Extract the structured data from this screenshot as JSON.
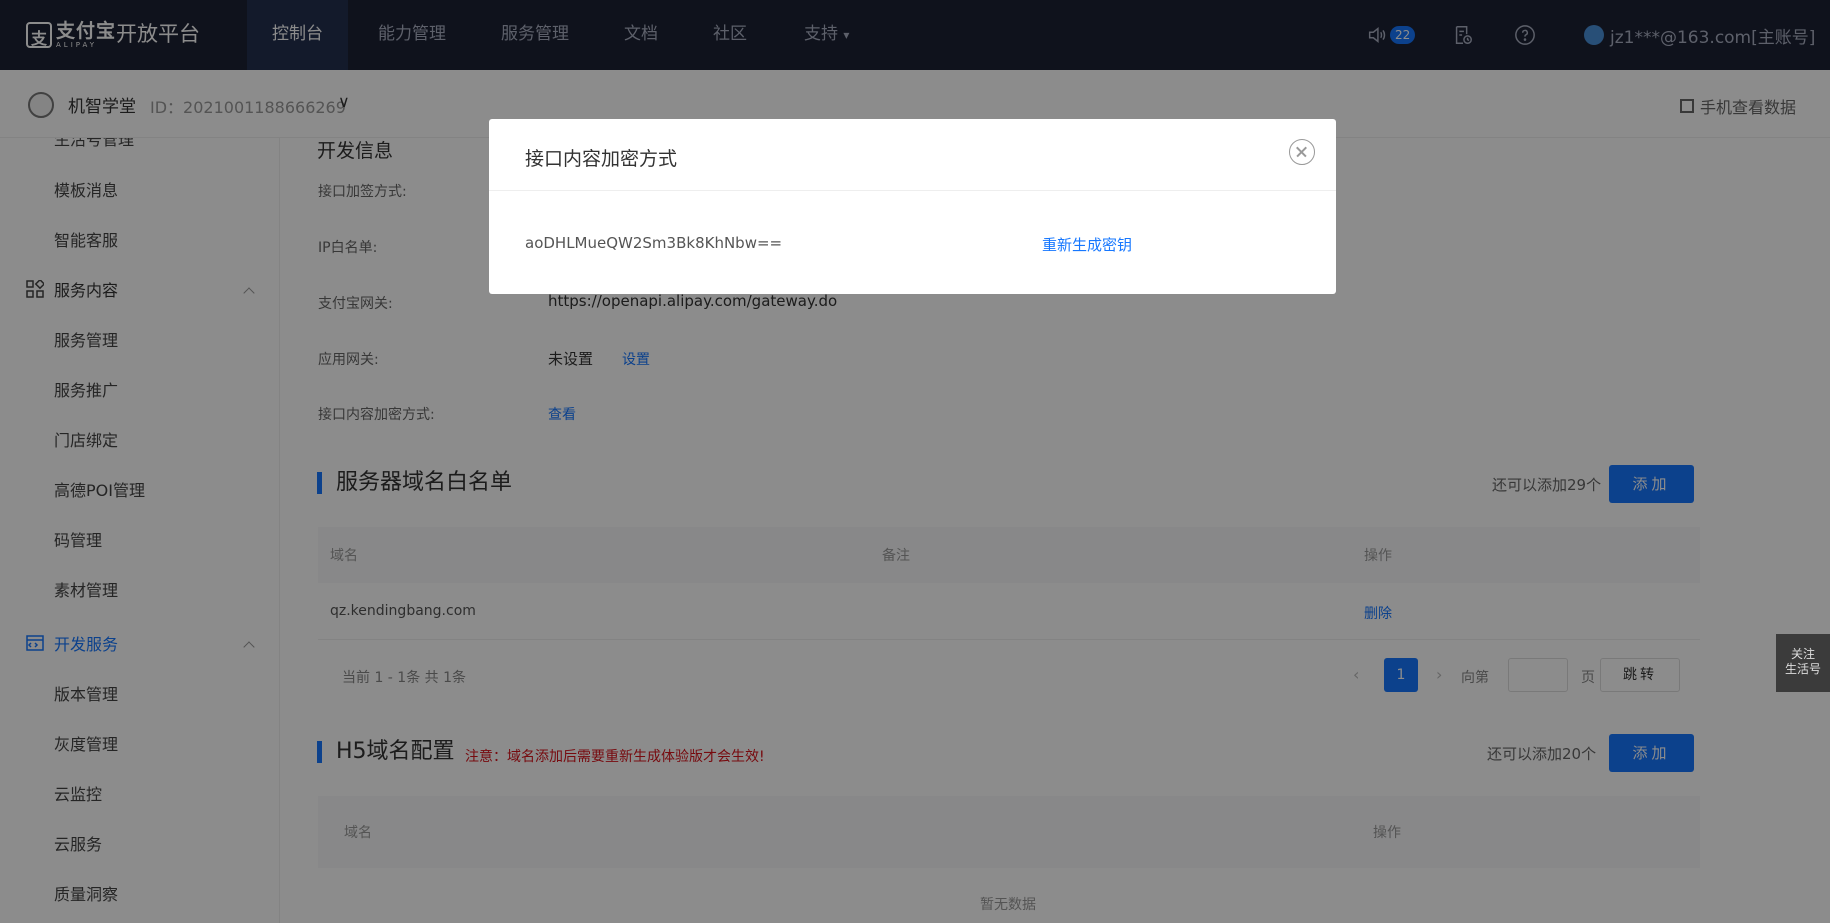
{
  "topnav": {
    "logo_cn": "支付宝",
    "logo_en": "ALIPAY",
    "platform": "开放平台",
    "items": [
      {
        "label": "控制台",
        "active": true
      },
      {
        "label": "能力管理"
      },
      {
        "label": "服务管理"
      },
      {
        "label": "文档"
      },
      {
        "label": "社区"
      },
      {
        "label": "支持"
      }
    ],
    "support_caret": "▾",
    "notify_count": "22",
    "account": "jz1***@163.com[主账号]"
  },
  "subheader": {
    "app_name": "机智学堂",
    "app_id": "ID：2021001188666269",
    "dropdown_glyph": "∨",
    "mobile_data": "手机查看数据"
  },
  "sidebar": {
    "items_top": [
      {
        "label": "生活号管理"
      },
      {
        "label": "模板消息"
      },
      {
        "label": "智能客服"
      }
    ],
    "group_service": {
      "label": "服务内容",
      "icon": "grid-icon"
    },
    "items_service": [
      {
        "label": "服务管理"
      },
      {
        "label": "服务推广"
      },
      {
        "label": "门店绑定"
      },
      {
        "label": "高德POI管理"
      },
      {
        "label": "码管理"
      },
      {
        "label": "素材管理"
      }
    ],
    "group_dev": {
      "label": "开发服务",
      "icon": "code-window-icon"
    },
    "items_dev": [
      {
        "label": "版本管理"
      },
      {
        "label": "灰度管理"
      },
      {
        "label": "云监控"
      },
      {
        "label": "云服务"
      },
      {
        "label": "质量洞察"
      }
    ]
  },
  "dev_info": {
    "title": "开发信息",
    "rows": [
      {
        "label": "接口加签方式:"
      },
      {
        "label": "IP白名单:"
      },
      {
        "label": "支付宝网关:",
        "value": "https://openapi.alipay.com/gateway.do"
      },
      {
        "label": "应用网关:",
        "value": "未设置",
        "link": "设置"
      },
      {
        "label": "接口内容加密方式:",
        "link": "查看"
      }
    ]
  },
  "server_whitelist": {
    "title": "服务器域名白名单",
    "remain": "还可以添加29个",
    "add_label": "添加",
    "columns": [
      "域名",
      "备注",
      "操作"
    ],
    "rows": [
      {
        "domain": "qz.kendingbang.com",
        "note": "",
        "action": "删除"
      }
    ],
    "pager": {
      "summary": "当前 1 - 1条 共 1条",
      "current_page": "1",
      "prev": "‹",
      "next": "›",
      "goto_prefix": "向第",
      "goto_suffix": "页",
      "jump_label": "跳转"
    }
  },
  "h5_config": {
    "title": "H5域名配置",
    "warning": "注意：域名添加后需要重新生成体验版才会生效!",
    "remain": "还可以添加20个",
    "add_label": "添加",
    "columns": [
      "域名",
      "操作"
    ],
    "empty": "暂无数据"
  },
  "float_tag": {
    "line1": "关注",
    "line2": "生活号"
  },
  "modal": {
    "title": "接口内容加密方式",
    "key": "aoDHLMueQW2Sm3Bk8KhNbw==",
    "regenerate": "重新生成密钥"
  },
  "colors": {
    "accent": "#1677ff",
    "nav_bg": "#1d2234",
    "warning": "#d9141d"
  }
}
